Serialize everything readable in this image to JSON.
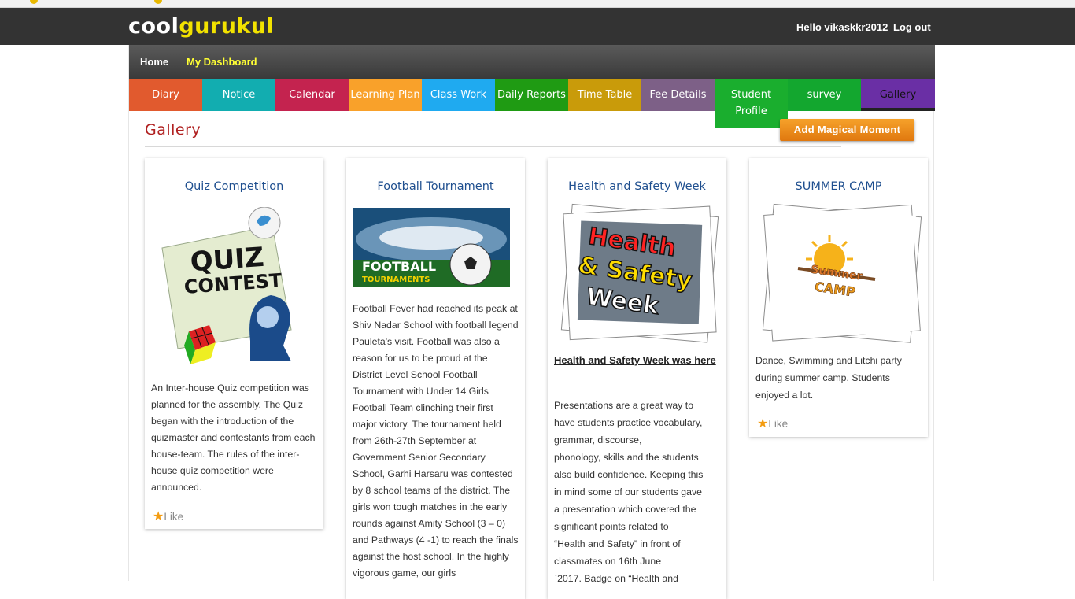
{
  "header": {
    "logo_part1": "cool",
    "logo_part2": "gurukul",
    "greeting": "Hello vikaskkr2012",
    "logout": "Log out"
  },
  "subnav": {
    "home": "Home",
    "dashboard": "My Dashboard"
  },
  "tabs": [
    {
      "label": "Diary",
      "color": "#e15a2e"
    },
    {
      "label": "Notice",
      "color": "#12adb0"
    },
    {
      "label": "Calendar",
      "color": "#c4234f"
    },
    {
      "label": "Learning Plan",
      "color": "#f9a12a"
    },
    {
      "label": "Class Work",
      "color": "#1faaf0"
    },
    {
      "label": "Daily Reports",
      "color": "#1f9b13"
    },
    {
      "label": "Time Table",
      "color": "#c99b0a"
    },
    {
      "label": "Fee Details",
      "color": "#7d6087"
    },
    {
      "label": "Student Profile",
      "color": "#1aae2e"
    },
    {
      "label": "survey",
      "color": "#13a72f"
    },
    {
      "label": "Gallery",
      "color": "#6a2fa5"
    }
  ],
  "page": {
    "title": "Gallery",
    "add_button": "Add Magical Moment"
  },
  "cards": [
    {
      "title": "Quiz Competition",
      "image_text": [
        "QUIZ",
        "CONTEST"
      ],
      "text": "An Inter-house Quiz competition was planned for the assembly. The Quiz began with the introduction of the quizmaster and contestants from each house-team. The rules of the inter-house quiz competition were announced.",
      "like": "Like"
    },
    {
      "title": "Football Tournament",
      "image_text": [
        "FOOTBALL",
        "TOURNAMENTS"
      ],
      "text": "Football Fever had reached its peak at Shiv Nadar School with football legend Pauleta's visit. Football was also a reason for us to be proud at the District Level School Football Tournament with Under 14 Girls Football Team clinching their first major victory. The tournament held from 26th-27th September at Government Senior Secondary School, Garhi Harsaru was contested by 8 school teams of the district. The girls won tough matches in the early rounds against Amity School (3 – 0) and Pathways (4 -1) to reach the finals against the host school. In the highly vigorous game, our girls"
    },
    {
      "title": "Health and Safety Week",
      "image_text": [
        "Health",
        "& Safety",
        "Week"
      ],
      "link_text": "Health and Safety Week was here",
      "text_lines": [
        "Presentations are a great way to",
        "have students practice vocabulary,",
        "grammar, discourse,",
        "phonology, skills and the students",
        "also build confidence. Keeping this",
        "in mind some of our students gave",
        "a presentation which covered the",
        "significant points related to",
        "“Health and Safety” in front of",
        "classmates on 16th June",
        "`2017. Badge on “Health and"
      ]
    },
    {
      "title": "SUMMER CAMP",
      "image_text": [
        "Summer",
        "CAMP"
      ],
      "text": "Dance, Swimming and Litchi party during summer camp. Students enjoyed a lot.",
      "like": "Like"
    }
  ]
}
